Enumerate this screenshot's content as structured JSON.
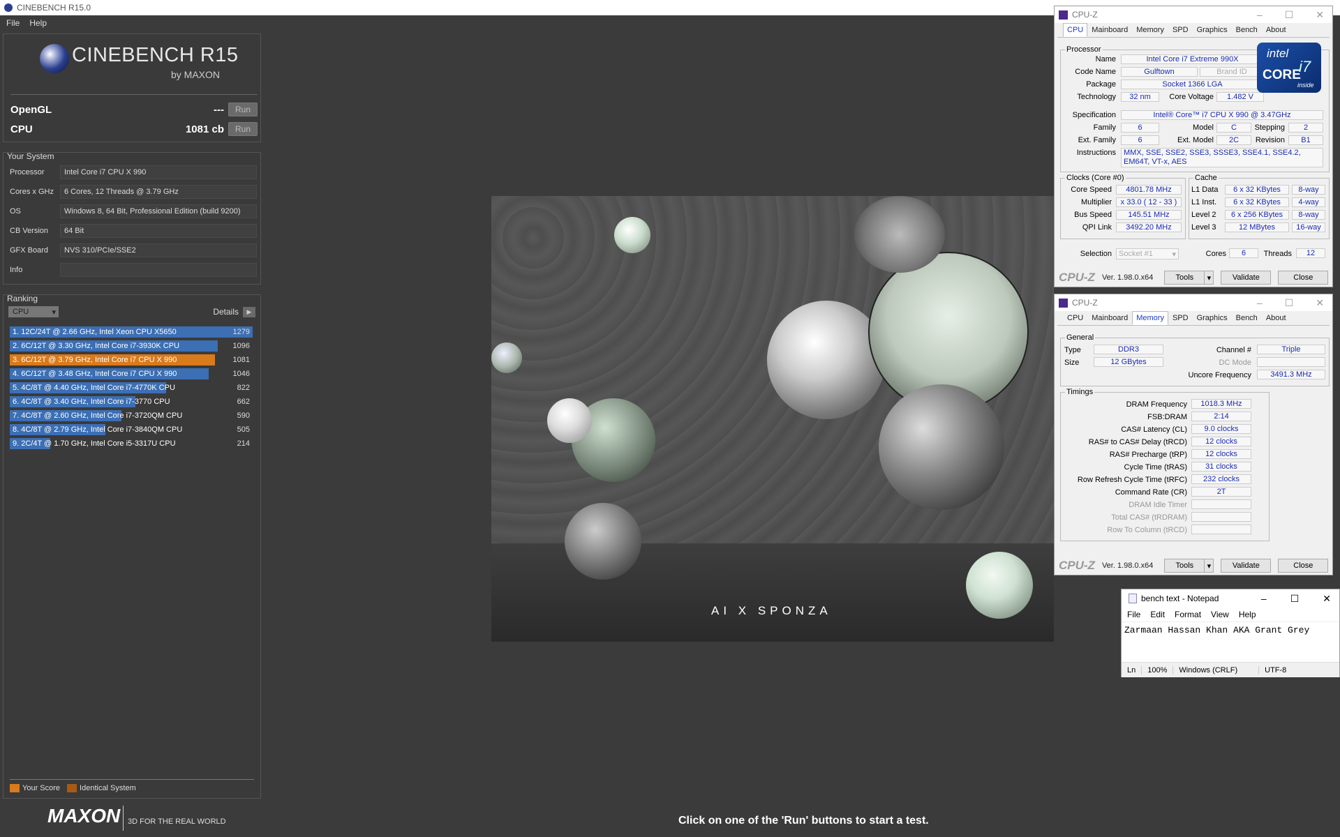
{
  "window": {
    "title": "CINEBENCH R15.0"
  },
  "menu": {
    "items": [
      "File",
      "Help"
    ]
  },
  "logo": {
    "name": "CINEBENCH R15",
    "by": "by MAXON"
  },
  "scores": [
    {
      "label": "OpenGL",
      "value": "---",
      "run": "Run"
    },
    {
      "label": "CPU",
      "value": "1081 cb",
      "run": "Run"
    }
  ],
  "system": {
    "title": "Your System",
    "rows": [
      {
        "k": "Processor",
        "v": "Intel Core i7 CPU X 990"
      },
      {
        "k": "Cores x GHz",
        "v": "6 Cores, 12 Threads @ 3.79 GHz"
      },
      {
        "k": "OS",
        "v": "Windows 8, 64 Bit, Professional Edition (build 9200)"
      },
      {
        "k": "CB Version",
        "v": "64 Bit"
      },
      {
        "k": "GFX Board",
        "v": "NVS 310/PCIe/SSE2"
      },
      {
        "k": "Info",
        "v": ""
      }
    ]
  },
  "ranking": {
    "title": "Ranking",
    "selector": "CPU",
    "details": "Details",
    "rows": [
      {
        "t": "1. 12C/24T @ 2.66 GHz, Intel Xeon CPU X5650",
        "s": "1279",
        "f": 1.0,
        "mine": false
      },
      {
        "t": "2. 6C/12T @ 3.30 GHz,  Intel Core i7-3930K CPU",
        "s": "1096",
        "f": 0.857,
        "mine": false
      },
      {
        "t": "3. 6C/12T @ 3.79 GHz, Intel Core i7 CPU X 990",
        "s": "1081",
        "f": 0.845,
        "mine": true
      },
      {
        "t": "4. 6C/12T @ 3.48 GHz, Intel Core i7 CPU X 990",
        "s": "1046",
        "f": 0.818,
        "mine": false
      },
      {
        "t": "5. 4C/8T @ 4.40 GHz, Intel Core i7-4770K CPU",
        "s": "822",
        "f": 0.643,
        "mine": false
      },
      {
        "t": "6. 4C/8T @ 3.40 GHz,  Intel Core i7-3770 CPU",
        "s": "662",
        "f": 0.518,
        "mine": false
      },
      {
        "t": "7. 4C/8T @ 2.60 GHz, Intel Core i7-3720QM CPU",
        "s": "590",
        "f": 0.461,
        "mine": false
      },
      {
        "t": "8. 4C/8T @ 2.79 GHz,  Intel Core i7-3840QM CPU",
        "s": "505",
        "f": 0.395,
        "mine": false
      },
      {
        "t": "9. 2C/4T @ 1.70 GHz,  Intel Core i5-3317U CPU",
        "s": "214",
        "f": 0.167,
        "mine": false
      }
    ],
    "legend": {
      "your": "Your Score",
      "identical": "Identical System"
    }
  },
  "footer": {
    "brand": "MAXON",
    "tagline": "3D FOR THE REAL WORLD",
    "status": "Click on one of the 'Run' buttons to start a test."
  },
  "render": {
    "watermark": "AI X SPONZA"
  },
  "cpuz1": {
    "title": "CPU-Z",
    "tabs": [
      "CPU",
      "Mainboard",
      "Memory",
      "SPD",
      "Graphics",
      "Bench",
      "About"
    ],
    "processor": "Processor",
    "name": "Intel Core i7 Extreme 990X",
    "codename": "Gulftown",
    "brandid": "Brand ID",
    "package": "Socket 1366 LGA",
    "technology": "32 nm",
    "corevoltage": "1.482 V",
    "spec": "Intel® Core™ i7 CPU       X 990  @ 3.47GHz",
    "family": "6",
    "model": "C",
    "stepping": "2",
    "extfamily": "6",
    "extmodel": "2C",
    "revision": "B1",
    "instructions": "MMX, SSE, SSE2, SSE3, SSSE3, SSE4.1, SSE4.2, EM64T, VT-x, AES",
    "clocks": "Clocks (Core #0)",
    "corespeed": "4801.78 MHz",
    "multiplier": "x 33.0 ( 12 - 33 )",
    "busspeed": "145.51 MHz",
    "qpilink": "3492.20 MHz",
    "cache": "Cache",
    "l1d": "6 x 32 KBytes",
    "l1dw": "8-way",
    "l1i": "6 x 32 KBytes",
    "l1iw": "4-way",
    "l2": "6 x 256 KBytes",
    "l2w": "8-way",
    "l3": "12 MBytes",
    "l3w": "16-way",
    "selection": "Socket #1",
    "cores": "6",
    "threads": "12",
    "labels": {
      "name": "Name",
      "codename": "Code Name",
      "package": "Package",
      "technology": "Technology",
      "corevoltage": "Core Voltage",
      "spec": "Specification",
      "family": "Family",
      "model": "Model",
      "stepping": "Stepping",
      "extfamily": "Ext. Family",
      "extmodel": "Ext. Model",
      "revision": "Revision",
      "instructions": "Instructions",
      "corespeed": "Core Speed",
      "multiplier": "Multiplier",
      "busspeed": "Bus Speed",
      "qpilink": "QPI Link",
      "l1d": "L1 Data",
      "l1i": "L1 Inst.",
      "l2": "Level 2",
      "l3": "Level 3",
      "selection": "Selection",
      "cores": "Cores",
      "threads": "Threads"
    },
    "intel": {
      "l1": "intel",
      "l2": "CORE",
      "l3": "i7",
      "l4": "inside"
    },
    "brand": "CPU-Z",
    "version": "Ver. 1.98.0.x64",
    "tools": "Tools",
    "validate": "Validate",
    "close": "Close"
  },
  "cpuz2": {
    "title": "CPU-Z",
    "tabs": [
      "CPU",
      "Mainboard",
      "Memory",
      "SPD",
      "Graphics",
      "Bench",
      "About"
    ],
    "general": "General",
    "type": "DDR3",
    "size": "12 GBytes",
    "channel": "Triple",
    "dcmode": "",
    "uncore": "3491.3 MHz",
    "timings": "Timings",
    "dram": "1018.3 MHz",
    "fsb": "2:14",
    "cl": "9.0 clocks",
    "trcd": "12 clocks",
    "trp": "12 clocks",
    "tras": "31 clocks",
    "trfc": "232 clocks",
    "cr": "2T",
    "labels": {
      "type": "Type",
      "size": "Size",
      "channel": "Channel #",
      "dcmode": "DC Mode",
      "uncore": "Uncore Frequency",
      "dram": "DRAM Frequency",
      "fsb": "FSB:DRAM",
      "cl": "CAS# Latency (CL)",
      "trcd": "RAS# to CAS# Delay (tRCD)",
      "trp": "RAS# Precharge (tRP)",
      "tras": "Cycle Time (tRAS)",
      "trfc": "Row Refresh Cycle Time (tRFC)",
      "cr": "Command Rate (CR)",
      "idle": "DRAM Idle Timer",
      "trdram": "Total CAS# (tRDRAM)",
      "rtc": "Row To Column (tRCD)"
    },
    "brand": "CPU-Z",
    "version": "Ver. 1.98.0.x64",
    "tools": "Tools",
    "validate": "Validate",
    "close": "Close"
  },
  "notepad": {
    "title": "bench text - Notepad",
    "menu": [
      "File",
      "Edit",
      "Format",
      "View",
      "Help"
    ],
    "text": "Zarmaan Hassan Khan AKA Grant Grey",
    "ln": "Ln",
    "zoom": "100%",
    "eol": "Windows (CRLF)",
    "enc": "UTF-8"
  }
}
